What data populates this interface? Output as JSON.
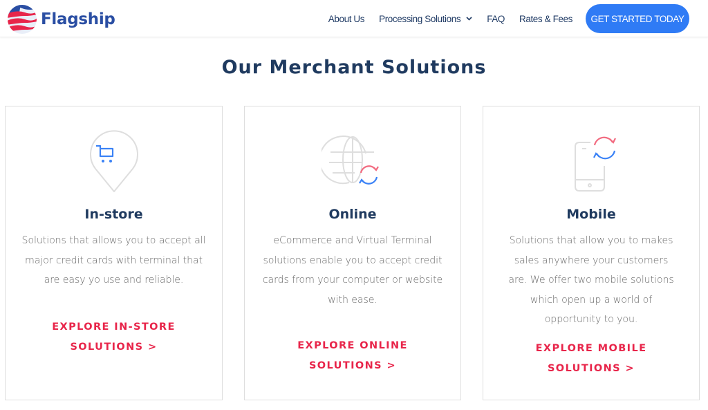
{
  "brand": {
    "name": "Flagship",
    "logo_icon": "flag-globe-icon",
    "colors": {
      "blue": "#2a4ea3",
      "red": "#e8254a"
    }
  },
  "nav": {
    "items": [
      {
        "label": "About Us",
        "has_dropdown": false
      },
      {
        "label": "Processing Solutions",
        "has_dropdown": true
      },
      {
        "label": "FAQ",
        "has_dropdown": false
      },
      {
        "label": "Rates & Fees",
        "has_dropdown": false
      }
    ],
    "cta_label": "GET STARTED TODAY",
    "cta_color": "#2f7bf5"
  },
  "main": {
    "title": "Our Merchant Solutions",
    "cards": [
      {
        "icon": "shopping-cart-pin-icon",
        "title": "In-store",
        "desc": "Solutions that allows you to accept all major credit cards with terminal that are easy yo use and reliable.",
        "link": "EXPLORE IN-STORE SOLUTIONS >"
      },
      {
        "icon": "globe-sync-icon",
        "title": "Online",
        "desc": "eCommerce and Virtual Terminal solutions enable you to accept credit cards from your computer or website with ease.",
        "link": "EXPLORE ONLINE SOLUTIONS >"
      },
      {
        "icon": "phone-sync-icon",
        "title": "Mobile",
        "desc": "Solutions that allow you to makes sales anywhere your customers are. We offer two mobile solutions which open up a world of opportunity to you.",
        "link": "EXPLORE MOBILE SOLUTIONS >"
      }
    ]
  }
}
